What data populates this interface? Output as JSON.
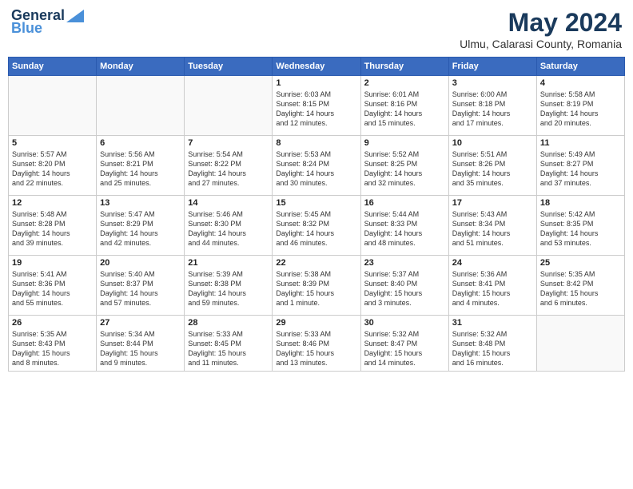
{
  "header": {
    "logo_line1": "General",
    "logo_line2": "Blue",
    "month": "May 2024",
    "location": "Ulmu, Calarasi County, Romania"
  },
  "weekdays": [
    "Sunday",
    "Monday",
    "Tuesday",
    "Wednesday",
    "Thursday",
    "Friday",
    "Saturday"
  ],
  "weeks": [
    [
      {
        "day": "",
        "info": ""
      },
      {
        "day": "",
        "info": ""
      },
      {
        "day": "",
        "info": ""
      },
      {
        "day": "1",
        "info": "Sunrise: 6:03 AM\nSunset: 8:15 PM\nDaylight: 14 hours\nand 12 minutes."
      },
      {
        "day": "2",
        "info": "Sunrise: 6:01 AM\nSunset: 8:16 PM\nDaylight: 14 hours\nand 15 minutes."
      },
      {
        "day": "3",
        "info": "Sunrise: 6:00 AM\nSunset: 8:18 PM\nDaylight: 14 hours\nand 17 minutes."
      },
      {
        "day": "4",
        "info": "Sunrise: 5:58 AM\nSunset: 8:19 PM\nDaylight: 14 hours\nand 20 minutes."
      }
    ],
    [
      {
        "day": "5",
        "info": "Sunrise: 5:57 AM\nSunset: 8:20 PM\nDaylight: 14 hours\nand 22 minutes."
      },
      {
        "day": "6",
        "info": "Sunrise: 5:56 AM\nSunset: 8:21 PM\nDaylight: 14 hours\nand 25 minutes."
      },
      {
        "day": "7",
        "info": "Sunrise: 5:54 AM\nSunset: 8:22 PM\nDaylight: 14 hours\nand 27 minutes."
      },
      {
        "day": "8",
        "info": "Sunrise: 5:53 AM\nSunset: 8:24 PM\nDaylight: 14 hours\nand 30 minutes."
      },
      {
        "day": "9",
        "info": "Sunrise: 5:52 AM\nSunset: 8:25 PM\nDaylight: 14 hours\nand 32 minutes."
      },
      {
        "day": "10",
        "info": "Sunrise: 5:51 AM\nSunset: 8:26 PM\nDaylight: 14 hours\nand 35 minutes."
      },
      {
        "day": "11",
        "info": "Sunrise: 5:49 AM\nSunset: 8:27 PM\nDaylight: 14 hours\nand 37 minutes."
      }
    ],
    [
      {
        "day": "12",
        "info": "Sunrise: 5:48 AM\nSunset: 8:28 PM\nDaylight: 14 hours\nand 39 minutes."
      },
      {
        "day": "13",
        "info": "Sunrise: 5:47 AM\nSunset: 8:29 PM\nDaylight: 14 hours\nand 42 minutes."
      },
      {
        "day": "14",
        "info": "Sunrise: 5:46 AM\nSunset: 8:30 PM\nDaylight: 14 hours\nand 44 minutes."
      },
      {
        "day": "15",
        "info": "Sunrise: 5:45 AM\nSunset: 8:32 PM\nDaylight: 14 hours\nand 46 minutes."
      },
      {
        "day": "16",
        "info": "Sunrise: 5:44 AM\nSunset: 8:33 PM\nDaylight: 14 hours\nand 48 minutes."
      },
      {
        "day": "17",
        "info": "Sunrise: 5:43 AM\nSunset: 8:34 PM\nDaylight: 14 hours\nand 51 minutes."
      },
      {
        "day": "18",
        "info": "Sunrise: 5:42 AM\nSunset: 8:35 PM\nDaylight: 14 hours\nand 53 minutes."
      }
    ],
    [
      {
        "day": "19",
        "info": "Sunrise: 5:41 AM\nSunset: 8:36 PM\nDaylight: 14 hours\nand 55 minutes."
      },
      {
        "day": "20",
        "info": "Sunrise: 5:40 AM\nSunset: 8:37 PM\nDaylight: 14 hours\nand 57 minutes."
      },
      {
        "day": "21",
        "info": "Sunrise: 5:39 AM\nSunset: 8:38 PM\nDaylight: 14 hours\nand 59 minutes."
      },
      {
        "day": "22",
        "info": "Sunrise: 5:38 AM\nSunset: 8:39 PM\nDaylight: 15 hours\nand 1 minute."
      },
      {
        "day": "23",
        "info": "Sunrise: 5:37 AM\nSunset: 8:40 PM\nDaylight: 15 hours\nand 3 minutes."
      },
      {
        "day": "24",
        "info": "Sunrise: 5:36 AM\nSunset: 8:41 PM\nDaylight: 15 hours\nand 4 minutes."
      },
      {
        "day": "25",
        "info": "Sunrise: 5:35 AM\nSunset: 8:42 PM\nDaylight: 15 hours\nand 6 minutes."
      }
    ],
    [
      {
        "day": "26",
        "info": "Sunrise: 5:35 AM\nSunset: 8:43 PM\nDaylight: 15 hours\nand 8 minutes."
      },
      {
        "day": "27",
        "info": "Sunrise: 5:34 AM\nSunset: 8:44 PM\nDaylight: 15 hours\nand 9 minutes."
      },
      {
        "day": "28",
        "info": "Sunrise: 5:33 AM\nSunset: 8:45 PM\nDaylight: 15 hours\nand 11 minutes."
      },
      {
        "day": "29",
        "info": "Sunrise: 5:33 AM\nSunset: 8:46 PM\nDaylight: 15 hours\nand 13 minutes."
      },
      {
        "day": "30",
        "info": "Sunrise: 5:32 AM\nSunset: 8:47 PM\nDaylight: 15 hours\nand 14 minutes."
      },
      {
        "day": "31",
        "info": "Sunrise: 5:32 AM\nSunset: 8:48 PM\nDaylight: 15 hours\nand 16 minutes."
      },
      {
        "day": "",
        "info": ""
      }
    ]
  ]
}
